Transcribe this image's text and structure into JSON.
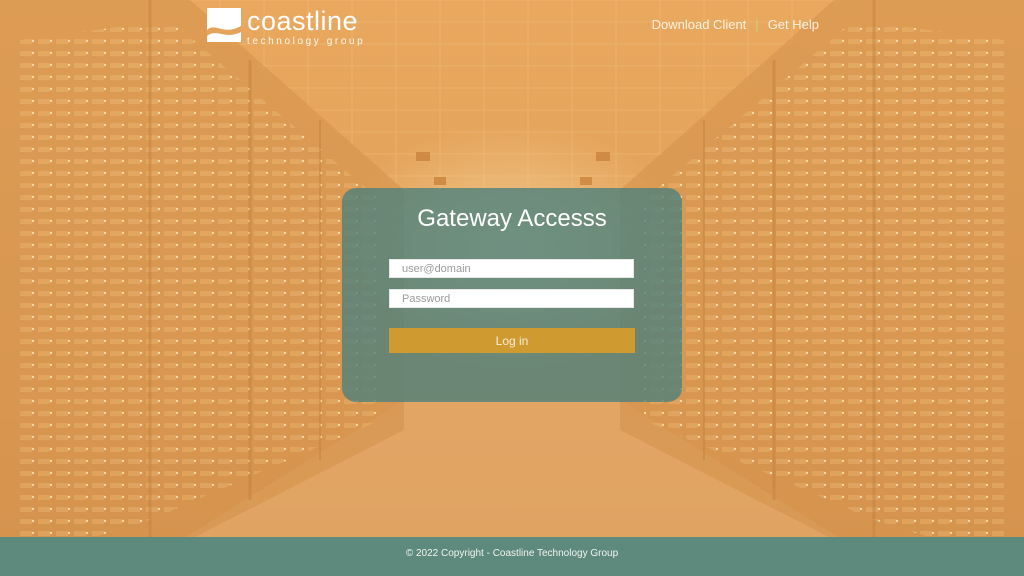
{
  "brand": {
    "name": "coastline",
    "tagline": "technology group"
  },
  "nav": {
    "download_label": "Download Client",
    "separator": "|",
    "help_label": "Get Help"
  },
  "login": {
    "title": "Gateway Accesss",
    "username_placeholder": "user@domain",
    "password_placeholder": "Password",
    "submit_label": "Log in"
  },
  "footer": {
    "copyright": "© 2022 Copyright - Coastline Technology Group"
  },
  "colors": {
    "background": "#e3a35a",
    "card": "#4a807c",
    "button": "#cf9b30",
    "footer": "#5e8a7d"
  }
}
